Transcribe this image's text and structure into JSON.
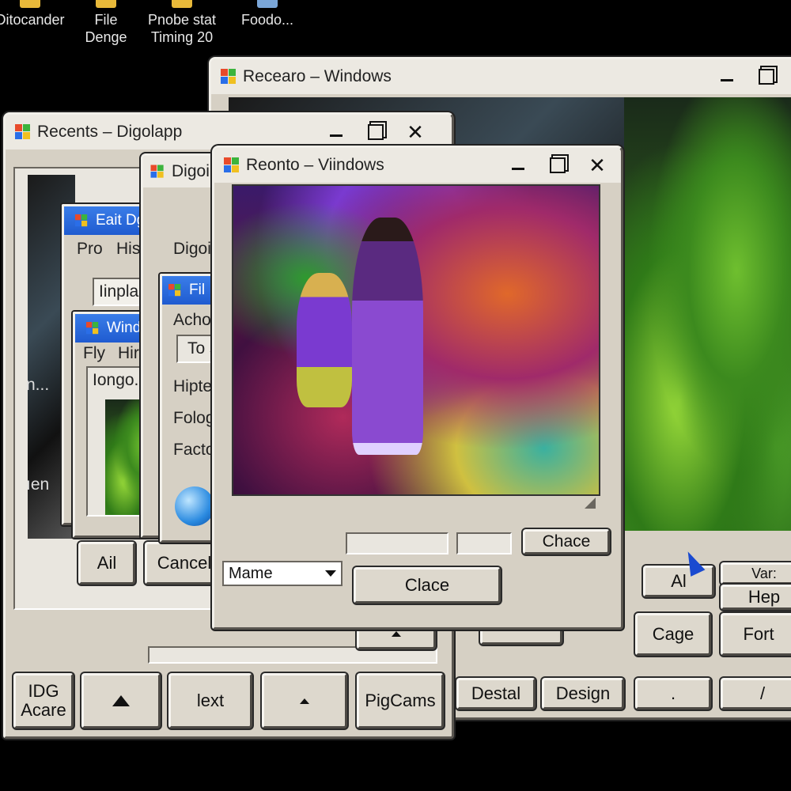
{
  "desktop": {
    "icons": [
      {
        "line1": "Ditocander",
        "line2": ""
      },
      {
        "line1": "File",
        "line2": "Denge"
      },
      {
        "line1": "Pnobe stat",
        "line2": "Timing 20"
      },
      {
        "line1": "Foodo...",
        "line2": ""
      }
    ]
  },
  "win_recearo": {
    "title": "Recearo – Windows",
    "buttons": {
      "al": "Al",
      "var": "Var:",
      "hep": "Hep",
      "cage": "Cage",
      "fort": "Fort",
      "destal": "Destal",
      "design": "Design",
      "dot": ".",
      "slash": "/"
    }
  },
  "win_recents": {
    "title": "Recents – Digolapp",
    "left_text": "n...",
    "left_text2": "ıen",
    "buttons": {
      "ail": "Ail",
      "cancel": "Cancel",
      "idg_line1": "IDG",
      "idg_line2": "Acare",
      "next": "lext",
      "pigcams": "PigCams"
    }
  },
  "win_eait": {
    "title": "Eait Dglima",
    "menu": [
      "Pro",
      "Hise"
    ],
    "field": "Iinplase"
  },
  "win_windds": {
    "title": "Windds",
    "menu": [
      "Fly",
      "Hire"
    ],
    "file": "Iongo."
  },
  "win_digo": {
    "title": "Digoi",
    "menu_item": "Digoi"
  },
  "win_fil": {
    "title": "Fil",
    "items": [
      "Acho",
      "To s",
      "Hipte",
      "Folog",
      "Facto"
    ]
  },
  "win_reonto": {
    "title": "Reonto – Viindows",
    "tab_label": "Chace",
    "select_value": "Mame",
    "close_button": "Clace"
  }
}
